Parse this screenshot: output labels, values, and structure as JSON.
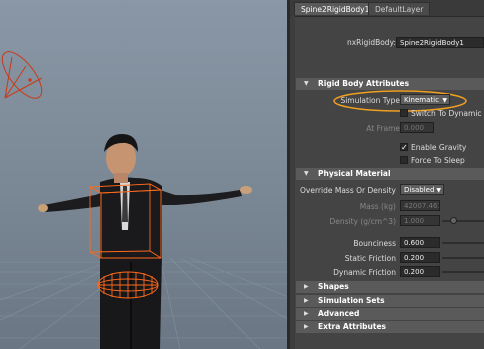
{
  "tabs": [
    "Spine2RigidBody1",
    "DefaultLayer"
  ],
  "node": {
    "label": "nxRigidBody:",
    "value": "Spine2RigidBody1"
  },
  "sections": {
    "rigid_body": "Rigid Body Attributes",
    "physical": "Physical Material",
    "shapes": "Shapes",
    "simulation_sets": "Simulation Sets",
    "advanced": "Advanced",
    "extra": "Extra Attributes"
  },
  "rigid": {
    "sim_type_label": "Simulation Type",
    "sim_type_value": "Kinematic",
    "switch_dynamic": "Switch To Dynamic",
    "at_frame_label": "At Frame",
    "at_frame_value": "0.000",
    "enable_gravity": "Enable Gravity",
    "enable_gravity_checked": true,
    "force_sleep": "Force To Sleep"
  },
  "physical": {
    "override_label": "Override Mass Or Density",
    "override_value": "Disabled",
    "mass_label": "Mass (kg)",
    "mass_value": "42007.461",
    "density_label": "Density (g/cm^3)",
    "density_value": "1.000",
    "bounciness_label": "Bounciness",
    "bounciness_value": "0.600",
    "static_label": "Static Friction",
    "static_value": "0.200",
    "dynamic_label": "Dynamic Friction",
    "dynamic_value": "0.200"
  },
  "colors": {
    "highlight": "#f0a020",
    "wire": "#ff6a1a"
  }
}
